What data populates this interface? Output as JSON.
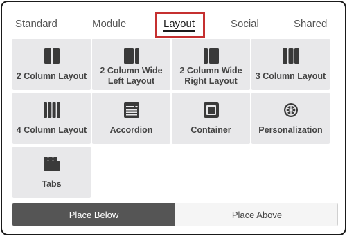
{
  "tabs": [
    {
      "label": "Standard"
    },
    {
      "label": "Module"
    },
    {
      "label": "Layout",
      "active": true
    },
    {
      "label": "Social"
    },
    {
      "label": "Shared"
    }
  ],
  "tiles": [
    {
      "label": "2 Column Layout",
      "icon": "two-column-icon"
    },
    {
      "label": "2 Column Wide Left Layout",
      "icon": "wide-left-icon"
    },
    {
      "label": "2 Column Wide Right Layout",
      "icon": "wide-right-icon"
    },
    {
      "label": "3 Column Layout",
      "icon": "three-column-icon"
    },
    {
      "label": "4 Column Layout",
      "icon": "four-column-icon"
    },
    {
      "label": "Accordion",
      "icon": "accordion-icon"
    },
    {
      "label": "Container",
      "icon": "container-icon"
    },
    {
      "label": "Personalization",
      "icon": "personalization-icon"
    },
    {
      "label": "Tabs",
      "icon": "tabs-icon"
    }
  ],
  "placement": {
    "below_label": "Place Below",
    "above_label": "Place Above",
    "selected": "below"
  },
  "colors": {
    "highlight": "#c53030",
    "tile_bg": "#e8e8ea",
    "icon": "#3a3a3a",
    "selected_button": "#555555"
  }
}
